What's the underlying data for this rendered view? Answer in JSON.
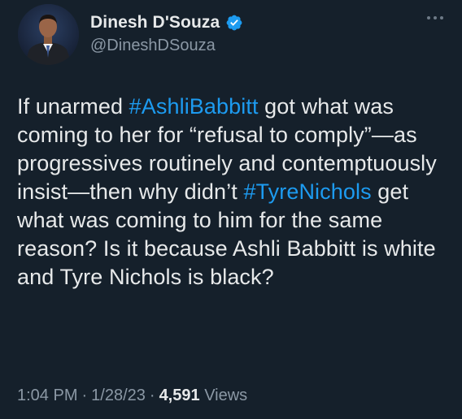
{
  "author": {
    "display_name": "Dinesh D'Souza",
    "handle": "@DineshDSouza",
    "verified_icon": "verified-badge-icon",
    "verified_color": "#1d9bf0"
  },
  "tweet": {
    "segments": [
      {
        "text": "If unarmed ",
        "type": "text"
      },
      {
        "text": "#AshliBabbitt",
        "type": "hashtag"
      },
      {
        "text": " got what was coming to her for “refusal to comply”—as progressives routinely and contemptuously insist—then why didn’t ",
        "type": "text"
      },
      {
        "text": "#TyreNichols",
        "type": "hashtag"
      },
      {
        "text": " get what was coming to him for the same reason? Is it because Ashli Babbitt is white and Tyre Nichols is black?",
        "type": "text"
      }
    ]
  },
  "meta": {
    "time": "1:04 PM",
    "separator": "·",
    "date": "1/28/23",
    "views_count": "4,591",
    "views_label": "Views"
  },
  "colors": {
    "background": "#15202b",
    "text": "#e7e9ea",
    "secondary_text": "#8b98a5",
    "accent": "#1d9bf0"
  }
}
